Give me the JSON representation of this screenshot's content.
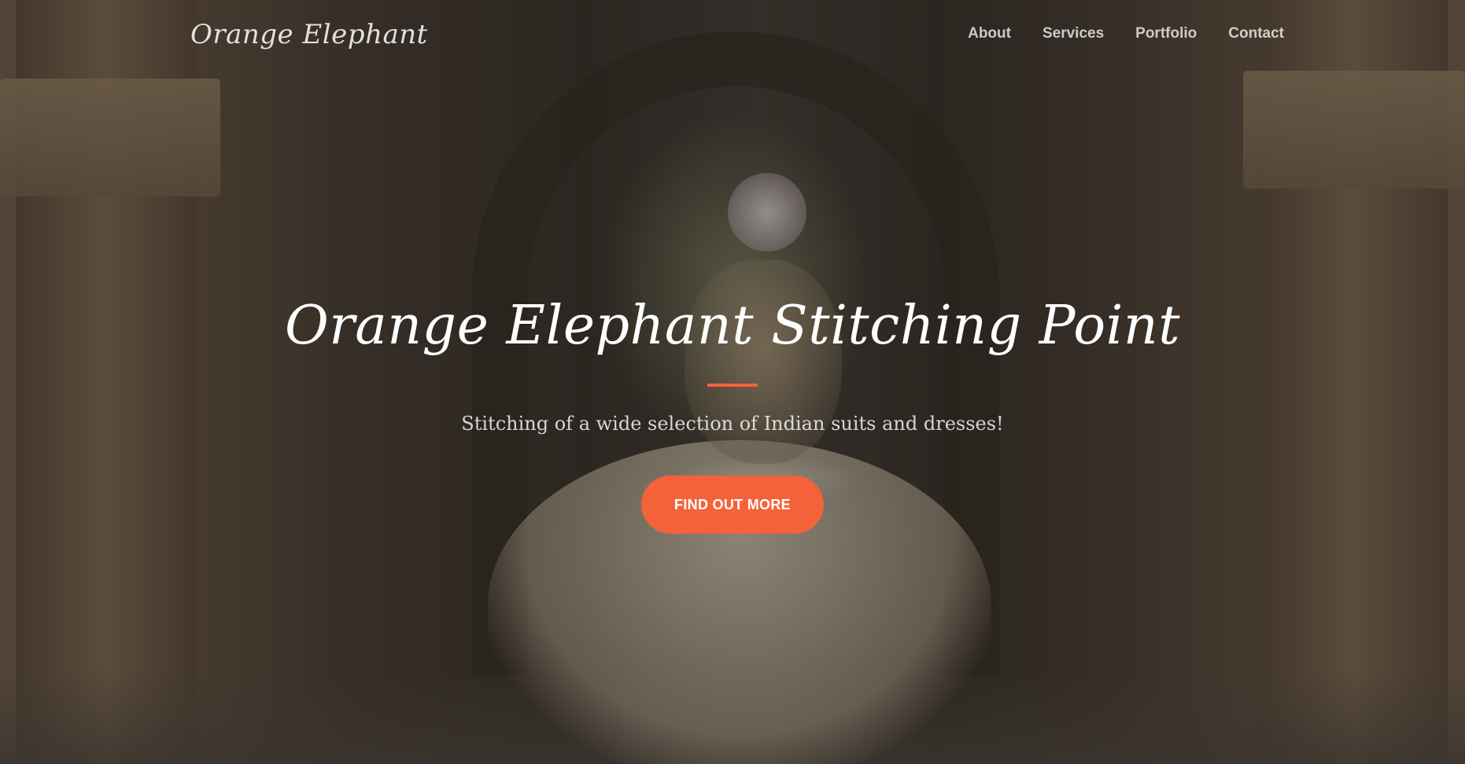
{
  "navbar": {
    "brand": "Orange Elephant",
    "links": [
      {
        "label": "About"
      },
      {
        "label": "Services"
      },
      {
        "label": "Portfolio"
      },
      {
        "label": "Contact"
      }
    ]
  },
  "hero": {
    "title": "Orange Elephant Stitching Point",
    "subtitle": "Stitching of a wide selection of Indian suits and dresses!",
    "cta_label": "FIND OUT MORE"
  },
  "colors": {
    "accent": "#f4623a",
    "text": "#ffffff"
  }
}
